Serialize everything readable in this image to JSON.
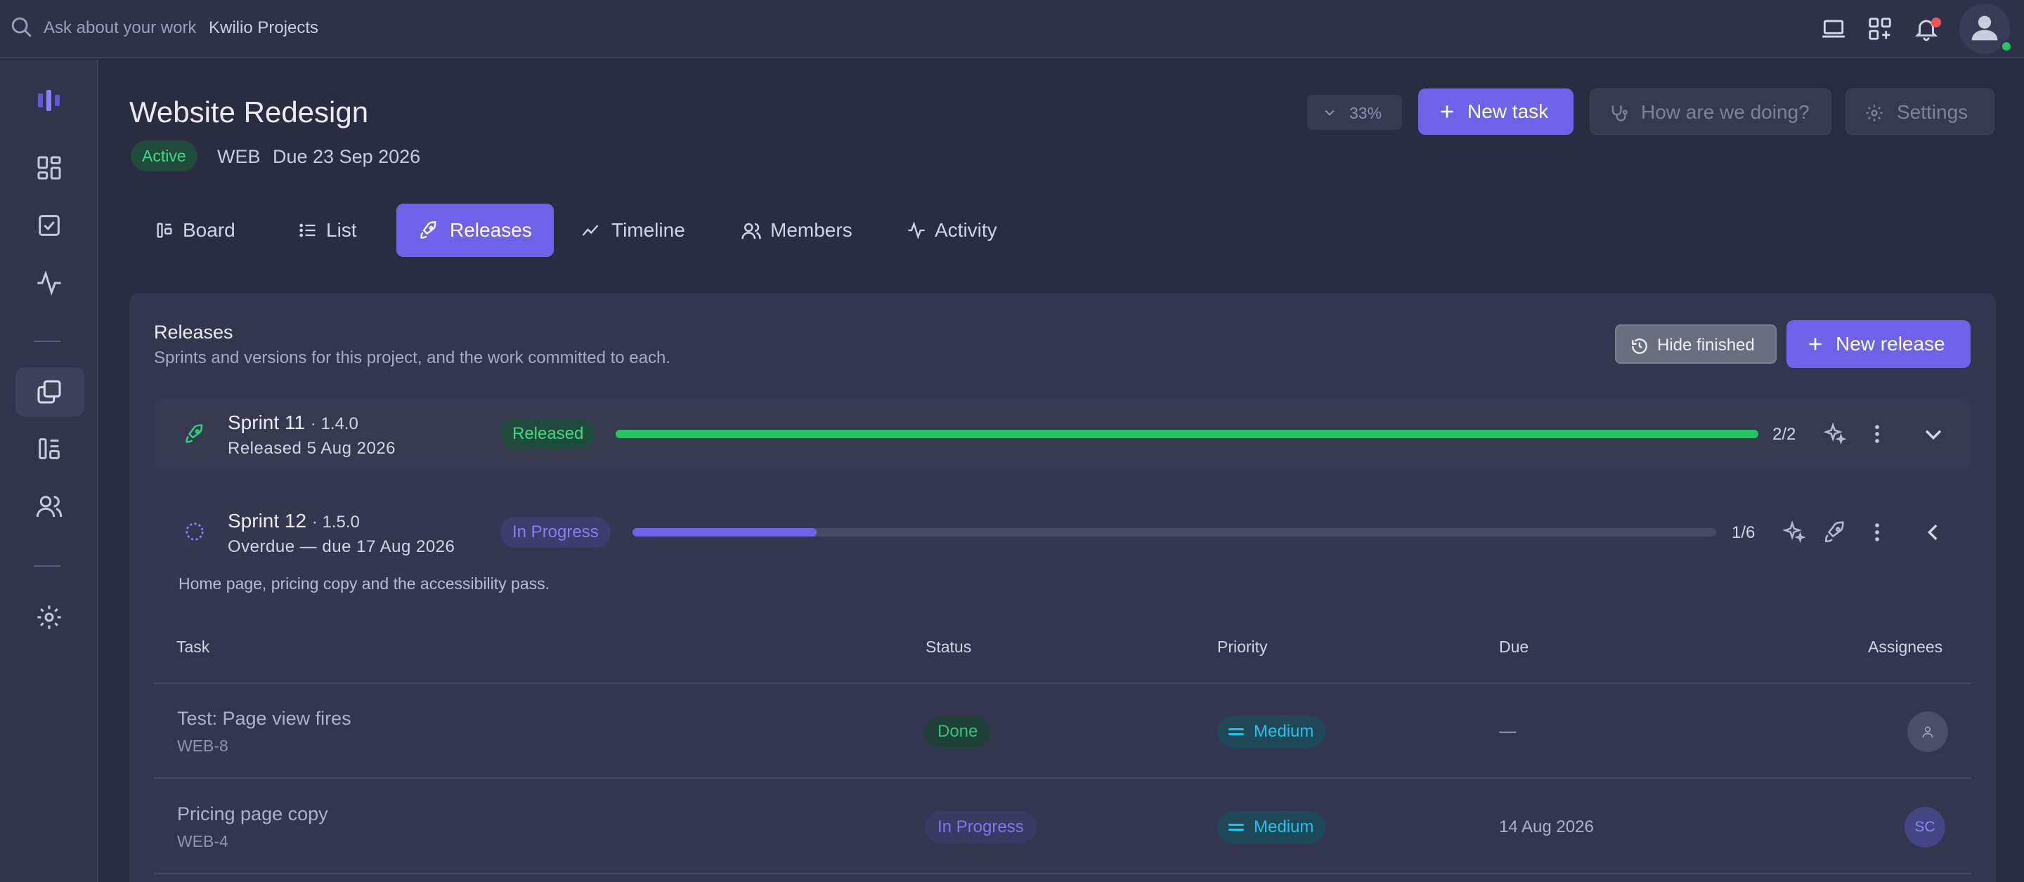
{
  "topbar": {
    "search_placeholder": "Ask about your work",
    "workspace": "Kwilio Projects",
    "icons": [
      "search-icon",
      "laptop-icon",
      "grid-plus-icon",
      "bell-icon",
      "user-icon"
    ]
  },
  "sidebar": {
    "items": [
      "logo-icon",
      "dashboard-icon",
      "tasks-icon",
      "activity-icon",
      "projects-icon",
      "board-icon",
      "people-icon",
      "settings-icon"
    ],
    "active": "projects-icon"
  },
  "project": {
    "title": "Website Redesign",
    "status": "Active",
    "code": "WEB",
    "due": "Due 23 Sep 2026",
    "progress_label": "33%",
    "new_task": "New task",
    "feedback": "How are we doing?",
    "settings": "Settings"
  },
  "tabs": [
    {
      "label": "Board",
      "icon": "board-icon"
    },
    {
      "label": "List",
      "icon": "list-icon"
    },
    {
      "label": "Releases",
      "icon": "rocket-icon",
      "active": true
    },
    {
      "label": "Timeline",
      "icon": "trend-icon"
    },
    {
      "label": "Members",
      "icon": "members-icon"
    },
    {
      "label": "Activity",
      "icon": "activity-icon"
    }
  ],
  "releases": {
    "title": "Releases",
    "subtitle": "Sprints and versions for this project, and the work committed to each.",
    "hide_finished": "Hide finished",
    "new_release": "New release",
    "items": [
      {
        "name": "Sprint 11",
        "version": "· 1.4.0",
        "date": "Released 5 Aug 2026",
        "status": "Released",
        "progress": 1.0,
        "count": "2/2",
        "expanded": false
      },
      {
        "name": "Sprint 12",
        "version": "· 1.5.0",
        "date": "Overdue — due 17 Aug 2026",
        "status": "In Progress",
        "progress": 0.17,
        "count": "1/6",
        "expanded": true,
        "description": "Home page, pricing copy and the accessibility pass."
      }
    ]
  },
  "table": {
    "headers": {
      "task": "Task",
      "status": "Status",
      "priority": "Priority",
      "due": "Due",
      "assignees": "Assignees"
    },
    "rows": [
      {
        "title": "Test: Page view fires",
        "key": "WEB-8",
        "status": "Done",
        "priority": "Medium",
        "due": "—",
        "assignee": ""
      },
      {
        "title": "Pricing page copy",
        "key": "WEB-4",
        "status": "In Progress",
        "priority": "Medium",
        "due": "14 Aug 2026",
        "assignee": "SC"
      }
    ]
  },
  "colors": {
    "accent": "#7062e8",
    "released_green": "#22c55e",
    "progress_purple": "#7062e8",
    "priority_cyan": "#22c3e6"
  }
}
